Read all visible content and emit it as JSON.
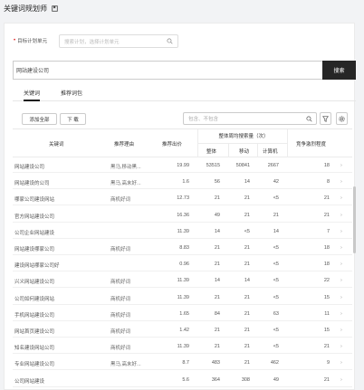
{
  "header": {
    "title": "关键词规划师",
    "icon": "bookmark-icon"
  },
  "plan": {
    "label": "目标计划单元",
    "placeholder": "搜索计划，选择计划单元"
  },
  "keyword_input": {
    "value": "网站建设公司"
  },
  "search_button": {
    "label": "搜索"
  },
  "tabs": [
    {
      "label": "关键词",
      "active": true
    },
    {
      "label": "推荐词包",
      "active": false
    }
  ],
  "toolbar": {
    "add_all_label": "添加全部",
    "download_label": "下 载",
    "filter_placeholder": "包含、不包含"
  },
  "table": {
    "headers": {
      "keyword": "关键词",
      "reason": "推荐理由",
      "bid": "推荐出价",
      "group": "整体周均搜索量（次）",
      "total": "整体",
      "mobile": "移动",
      "pc": "计算机",
      "competition": "竞争激烈程度"
    },
    "rows": [
      {
        "keyword": "网站建设公司",
        "reason": "黑马,移动黑...",
        "bid": "19.99",
        "total": "53515",
        "mobile": "50841",
        "pc": "2667",
        "competition": "18"
      },
      {
        "keyword": "网站建设的公司",
        "reason": "黑马,高末好...",
        "bid": "1.6",
        "total": "56",
        "mobile": "14",
        "pc": "42",
        "competition": "8"
      },
      {
        "keyword": "哪家公司建设网站",
        "reason": "商机好词",
        "bid": "12.73",
        "total": "21",
        "mobile": "21",
        "pc": "<5",
        "competition": "21"
      },
      {
        "keyword": "官方网站建设公司",
        "reason": "",
        "bid": "16.36",
        "total": "49",
        "mobile": "21",
        "pc": "21",
        "competition": "21"
      },
      {
        "keyword": "公司企业网站建设",
        "reason": "",
        "bid": "11.39",
        "total": "14",
        "mobile": "<5",
        "pc": "14",
        "competition": "7"
      },
      {
        "keyword": "网站建设哪家公司",
        "reason": "商机好词",
        "bid": "8.83",
        "total": "21",
        "mobile": "21",
        "pc": "<5",
        "competition": "18"
      },
      {
        "keyword": "建设网站哪家公司好",
        "reason": "",
        "bid": "0.96",
        "total": "21",
        "mobile": "21",
        "pc": "<5",
        "competition": "18"
      },
      {
        "keyword": "兴义网站建设公司",
        "reason": "商机好词",
        "bid": "11.39",
        "total": "14",
        "mobile": "14",
        "pc": "<5",
        "competition": "22"
      },
      {
        "keyword": "公司如何建设网站",
        "reason": "商机好词",
        "bid": "11.39",
        "total": "21",
        "mobile": "21",
        "pc": "<5",
        "competition": "15"
      },
      {
        "keyword": "手机网站建设公司",
        "reason": "商机好词",
        "bid": "1.65",
        "total": "84",
        "mobile": "21",
        "pc": "63",
        "competition": "11"
      },
      {
        "keyword": "网站首页建设公司",
        "reason": "商机好词",
        "bid": "1.42",
        "total": "21",
        "mobile": "21",
        "pc": "<5",
        "competition": "15"
      },
      {
        "keyword": "知名建设网站公司",
        "reason": "商机好词",
        "bid": "11.39",
        "total": "21",
        "mobile": "21",
        "pc": "<5",
        "competition": "21"
      },
      {
        "keyword": "专业网站建设公司",
        "reason": "黑马,高末好...",
        "bid": "8.7",
        "total": "483",
        "mobile": "21",
        "pc": "462",
        "competition": "9"
      },
      {
        "keyword": "公司网站建设",
        "reason": "",
        "bid": "5.6",
        "total": "364",
        "mobile": "308",
        "pc": "49",
        "competition": "21"
      }
    ]
  }
}
